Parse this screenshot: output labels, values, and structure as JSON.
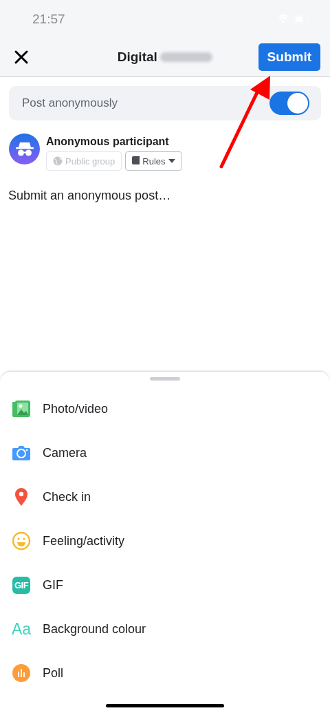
{
  "status_bar": {
    "time": "21:57"
  },
  "header": {
    "title": "Digital",
    "submit_label": "Submit"
  },
  "anonymous_toggle": {
    "label": "Post anonymously",
    "on": true
  },
  "author": {
    "name": "Anonymous participant",
    "chips": [
      {
        "label": "Public group",
        "kind": "privacy",
        "disabled": true
      },
      {
        "label": "Rules",
        "kind": "rules",
        "disabled": false
      }
    ]
  },
  "composer": {
    "placeholder": "Submit an anonymous post…"
  },
  "options": [
    {
      "label": "Photo/video",
      "kind": "photo"
    },
    {
      "label": "Camera",
      "kind": "camera"
    },
    {
      "label": "Check in",
      "kind": "checkin"
    },
    {
      "label": "Feeling/activity",
      "kind": "feeling"
    },
    {
      "label": "GIF",
      "kind": "gif",
      "icon_text": "GIF"
    },
    {
      "label": "Background colour",
      "kind": "background",
      "icon_text": "Aa"
    },
    {
      "label": "Poll",
      "kind": "poll"
    }
  ]
}
